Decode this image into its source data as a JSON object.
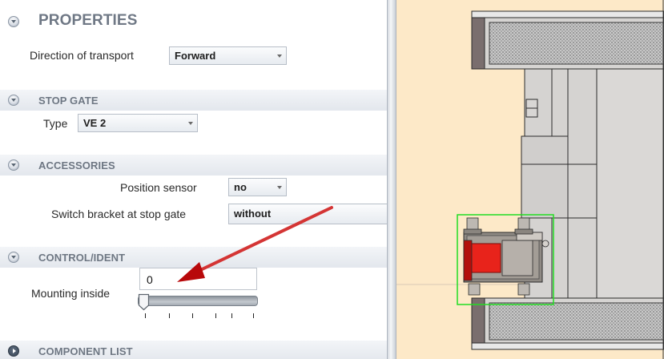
{
  "properties": {
    "title": "PROPERTIES",
    "direction_label": "Direction of transport",
    "direction_value": "Forward"
  },
  "stop_gate": {
    "title": "STOP GATE",
    "type_label": "Type",
    "type_value": "VE 2"
  },
  "accessories": {
    "title": "ACCESSORIES",
    "position_sensor_label": "Position sensor",
    "position_sensor_value": "no",
    "switch_bracket_label": "Switch bracket at stop gate",
    "switch_bracket_value": "without"
  },
  "control_ident": {
    "title": "CONTROL/IDENT",
    "mounting_label": "Mounting inside",
    "mounting_value": "0",
    "slider_fraction": 0.0
  },
  "component_list": {
    "title": "COMPONENT LIST"
  },
  "colors": {
    "section_header": "#e3e7ed",
    "annotation_arrow": "#c8181a",
    "viewport_background": "#fde9c8",
    "selection_outline": "#22dd22",
    "stop_gate_red": "#e8231b"
  }
}
